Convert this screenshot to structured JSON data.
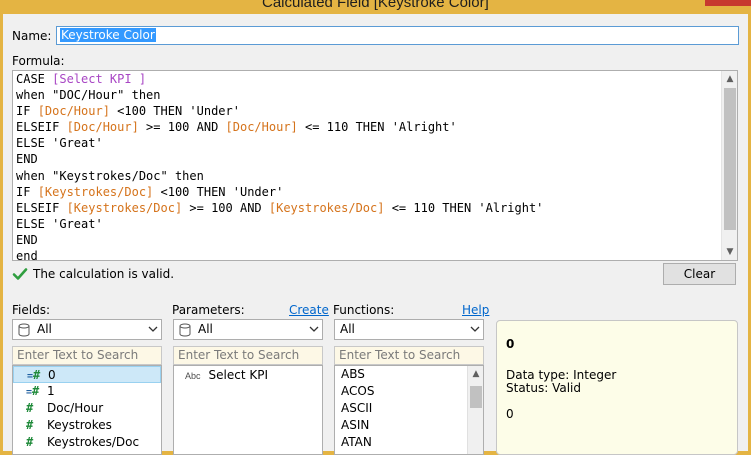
{
  "window": {
    "title": "Calculated Field [Keystroke Color]"
  },
  "name_field": {
    "label": "Name:",
    "value": "Keystroke Color"
  },
  "formula": {
    "label": "Formula:",
    "lines": [
      [
        {
          "t": "CASE "
        },
        {
          "t": "[Select KPI ]",
          "c": "p"
        }
      ],
      [
        {
          "t": "when \"DOC/Hour\" then"
        }
      ],
      [
        {
          "t": "IF "
        },
        {
          "t": "[Doc/Hour]",
          "c": "f"
        },
        {
          "t": " <100 THEN 'Under'"
        }
      ],
      [
        {
          "t": "ELSEIF "
        },
        {
          "t": "[Doc/Hour]",
          "c": "f"
        },
        {
          "t": " >= 100 AND "
        },
        {
          "t": "[Doc/Hour]",
          "c": "f"
        },
        {
          "t": " <= 110 THEN 'Alright'"
        }
      ],
      [
        {
          "t": "ELSE 'Great'"
        }
      ],
      [
        {
          "t": "END"
        }
      ],
      [
        {
          "t": "when \"Keystrokes/Doc\" then"
        }
      ],
      [
        {
          "t": "IF "
        },
        {
          "t": "[Keystrokes/Doc]",
          "c": "f"
        },
        {
          "t": " <100 THEN 'Under'"
        }
      ],
      [
        {
          "t": "ELSEIF "
        },
        {
          "t": "[Keystrokes/Doc]",
          "c": "f"
        },
        {
          "t": " >= 100 AND "
        },
        {
          "t": "[Keystrokes/Doc]",
          "c": "f"
        },
        {
          "t": " <= 110 THEN 'Alright'"
        }
      ],
      [
        {
          "t": "ELSE 'Great'"
        }
      ],
      [
        {
          "t": "END"
        }
      ],
      [
        {
          "t": "end"
        }
      ]
    ],
    "colors": {
      "field": "#d5731b",
      "parameter": "#a846c4"
    }
  },
  "status": {
    "message": "The calculation is valid.",
    "icon": "checkmark-icon"
  },
  "clear_label": "Clear",
  "fields": {
    "label": "Fields:",
    "filter": "All",
    "search_placeholder": "Enter Text to Search",
    "items": [
      {
        "label": "0",
        "icon": "=#"
      },
      {
        "label": "1",
        "icon": "=#"
      },
      {
        "label": "Doc/Hour",
        "icon": "#"
      },
      {
        "label": "Keystrokes",
        "icon": "#"
      },
      {
        "label": "Keystrokes/Doc",
        "icon": "#"
      }
    ]
  },
  "parameters": {
    "label": "Parameters:",
    "create_label": "Create",
    "filter": "All",
    "search_placeholder": "Enter Text to Search",
    "items": [
      {
        "label": "Select KPI",
        "icon": "Abc"
      }
    ]
  },
  "functions": {
    "label": "Functions:",
    "help_label": "Help",
    "filter": "All",
    "search_placeholder": "Enter Text to Search",
    "items": [
      "ABS",
      "ACOS",
      "ASCII",
      "ASIN",
      "ATAN"
    ]
  },
  "info": {
    "title": "0",
    "data_type": "Data type: Integer",
    "status": "Status: Valid",
    "value": "0"
  }
}
